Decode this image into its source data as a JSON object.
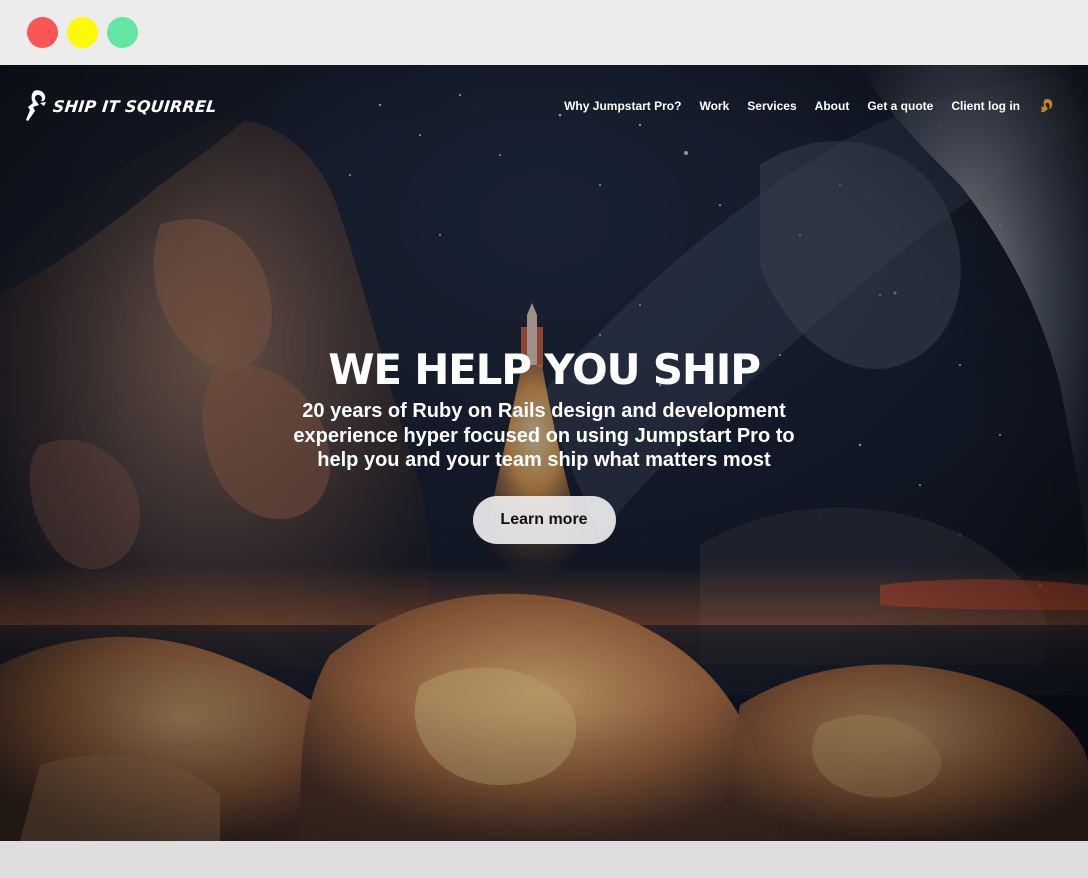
{
  "window": {
    "controls": [
      "close",
      "minimize",
      "maximize"
    ]
  },
  "site": {
    "logo_text": "SHIP IT SQUIRREL",
    "nav": [
      {
        "label": "Why Jumpstart Pro?"
      },
      {
        "label": "Work"
      },
      {
        "label": "Services"
      },
      {
        "label": "About"
      },
      {
        "label": "Get a quote"
      },
      {
        "label": "Client log in"
      }
    ],
    "nav_icon": "squirrel-icon"
  },
  "hero": {
    "headline": "WE HELP YOU SHIP",
    "subheadline": "20 years of Ruby on Rails design and development experience hyper focused on using Jumpstart Pro to help you and your team ship what matters most",
    "cta_label": "Learn more",
    "background": "rocket-launch-image"
  },
  "colors": {
    "close": "#fb5656",
    "minimize": "#fdfa04",
    "maximize": "#63e6a1",
    "text": "#ffffff",
    "cta_bg": "#ededed"
  }
}
